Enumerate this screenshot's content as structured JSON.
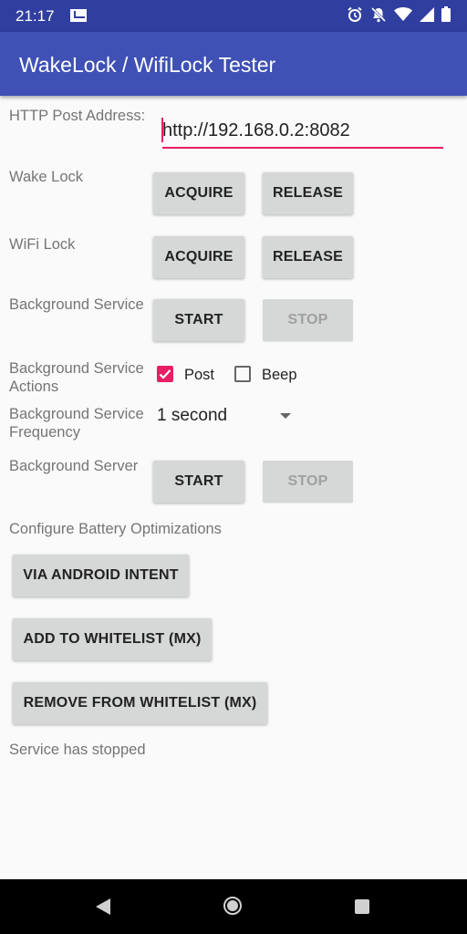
{
  "status_bar": {
    "time": "21:17",
    "icons": [
      "gmail-icon",
      "alarm-icon",
      "notifications-off-icon",
      "wifi-icon",
      "signal-icon",
      "battery-icon"
    ]
  },
  "app_bar": {
    "title": "WakeLock / WifiLock Tester"
  },
  "http_post": {
    "label": "HTTP Post Address:",
    "value": "http://192.168.0.2:8082"
  },
  "wake_lock": {
    "label": "Wake Lock",
    "acquire": "ACQUIRE",
    "release": "RELEASE"
  },
  "wifi_lock": {
    "label": "WiFi Lock",
    "acquire": "ACQUIRE",
    "release": "RELEASE"
  },
  "background_service": {
    "label": "Background Service",
    "start": "START",
    "stop": "STOP"
  },
  "background_service_actions": {
    "label": "Background Service Actions",
    "post": {
      "label": "Post",
      "checked": true
    },
    "beep": {
      "label": "Beep",
      "checked": false
    }
  },
  "background_service_frequency": {
    "label": "Background Service Frequency",
    "selected": "1 second"
  },
  "background_server": {
    "label": "Background Server",
    "start": "START",
    "stop": "STOP"
  },
  "battery": {
    "label": "Configure Battery Optimizations",
    "via_intent": "VIA ANDROID INTENT",
    "add_whitelist": "ADD TO WHITELIST (MX)",
    "remove_whitelist": "REMOVE FROM WHITELIST (MX)"
  },
  "status_text": "Service has stopped",
  "colors": {
    "primary": "#3F51B5",
    "primary_dark": "#303F9F",
    "accent": "#E91E63"
  }
}
